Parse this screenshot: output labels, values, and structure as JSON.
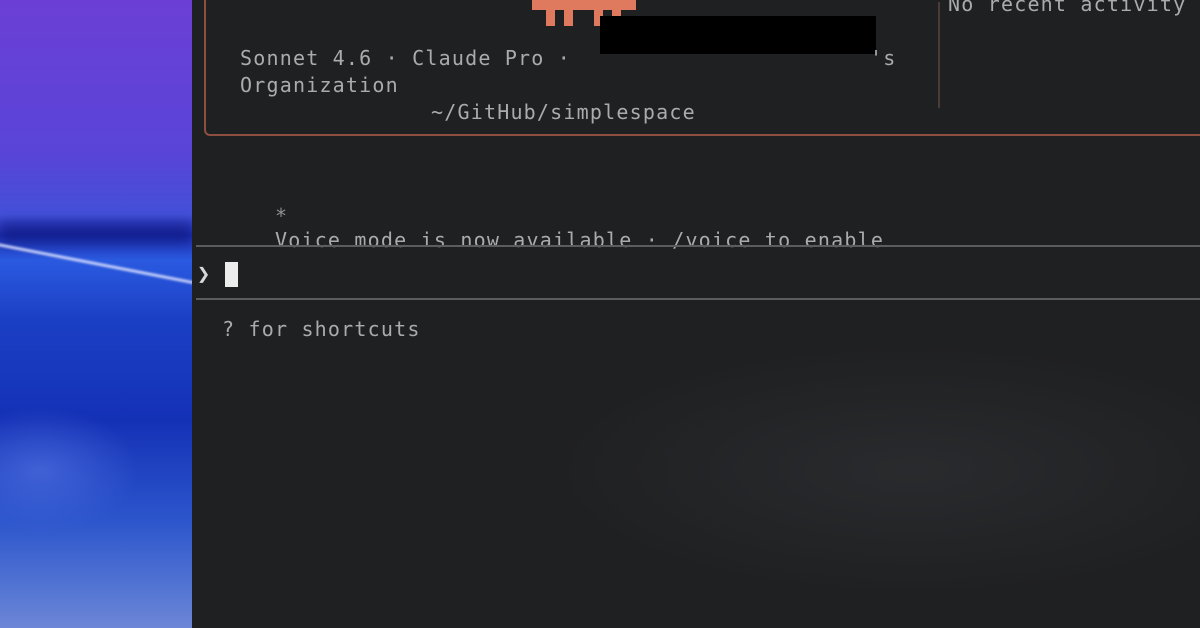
{
  "header": {
    "model_info": "Sonnet 4.6 · Claude Pro ·",
    "org_suffix": "'s",
    "org_line": "Organization",
    "cwd": "~/GitHub/simplespace"
  },
  "recent_activity": "No recent activity",
  "tip": {
    "icon": "*",
    "text": "Voice mode is now available · /voice to enable"
  },
  "prompt": {
    "symbol": "❯",
    "value": ""
  },
  "footer_hint": "? for shortcuts",
  "colors": {
    "accent": "#e07a5f",
    "border": "#8e4f3e",
    "background": "#1f2022"
  }
}
